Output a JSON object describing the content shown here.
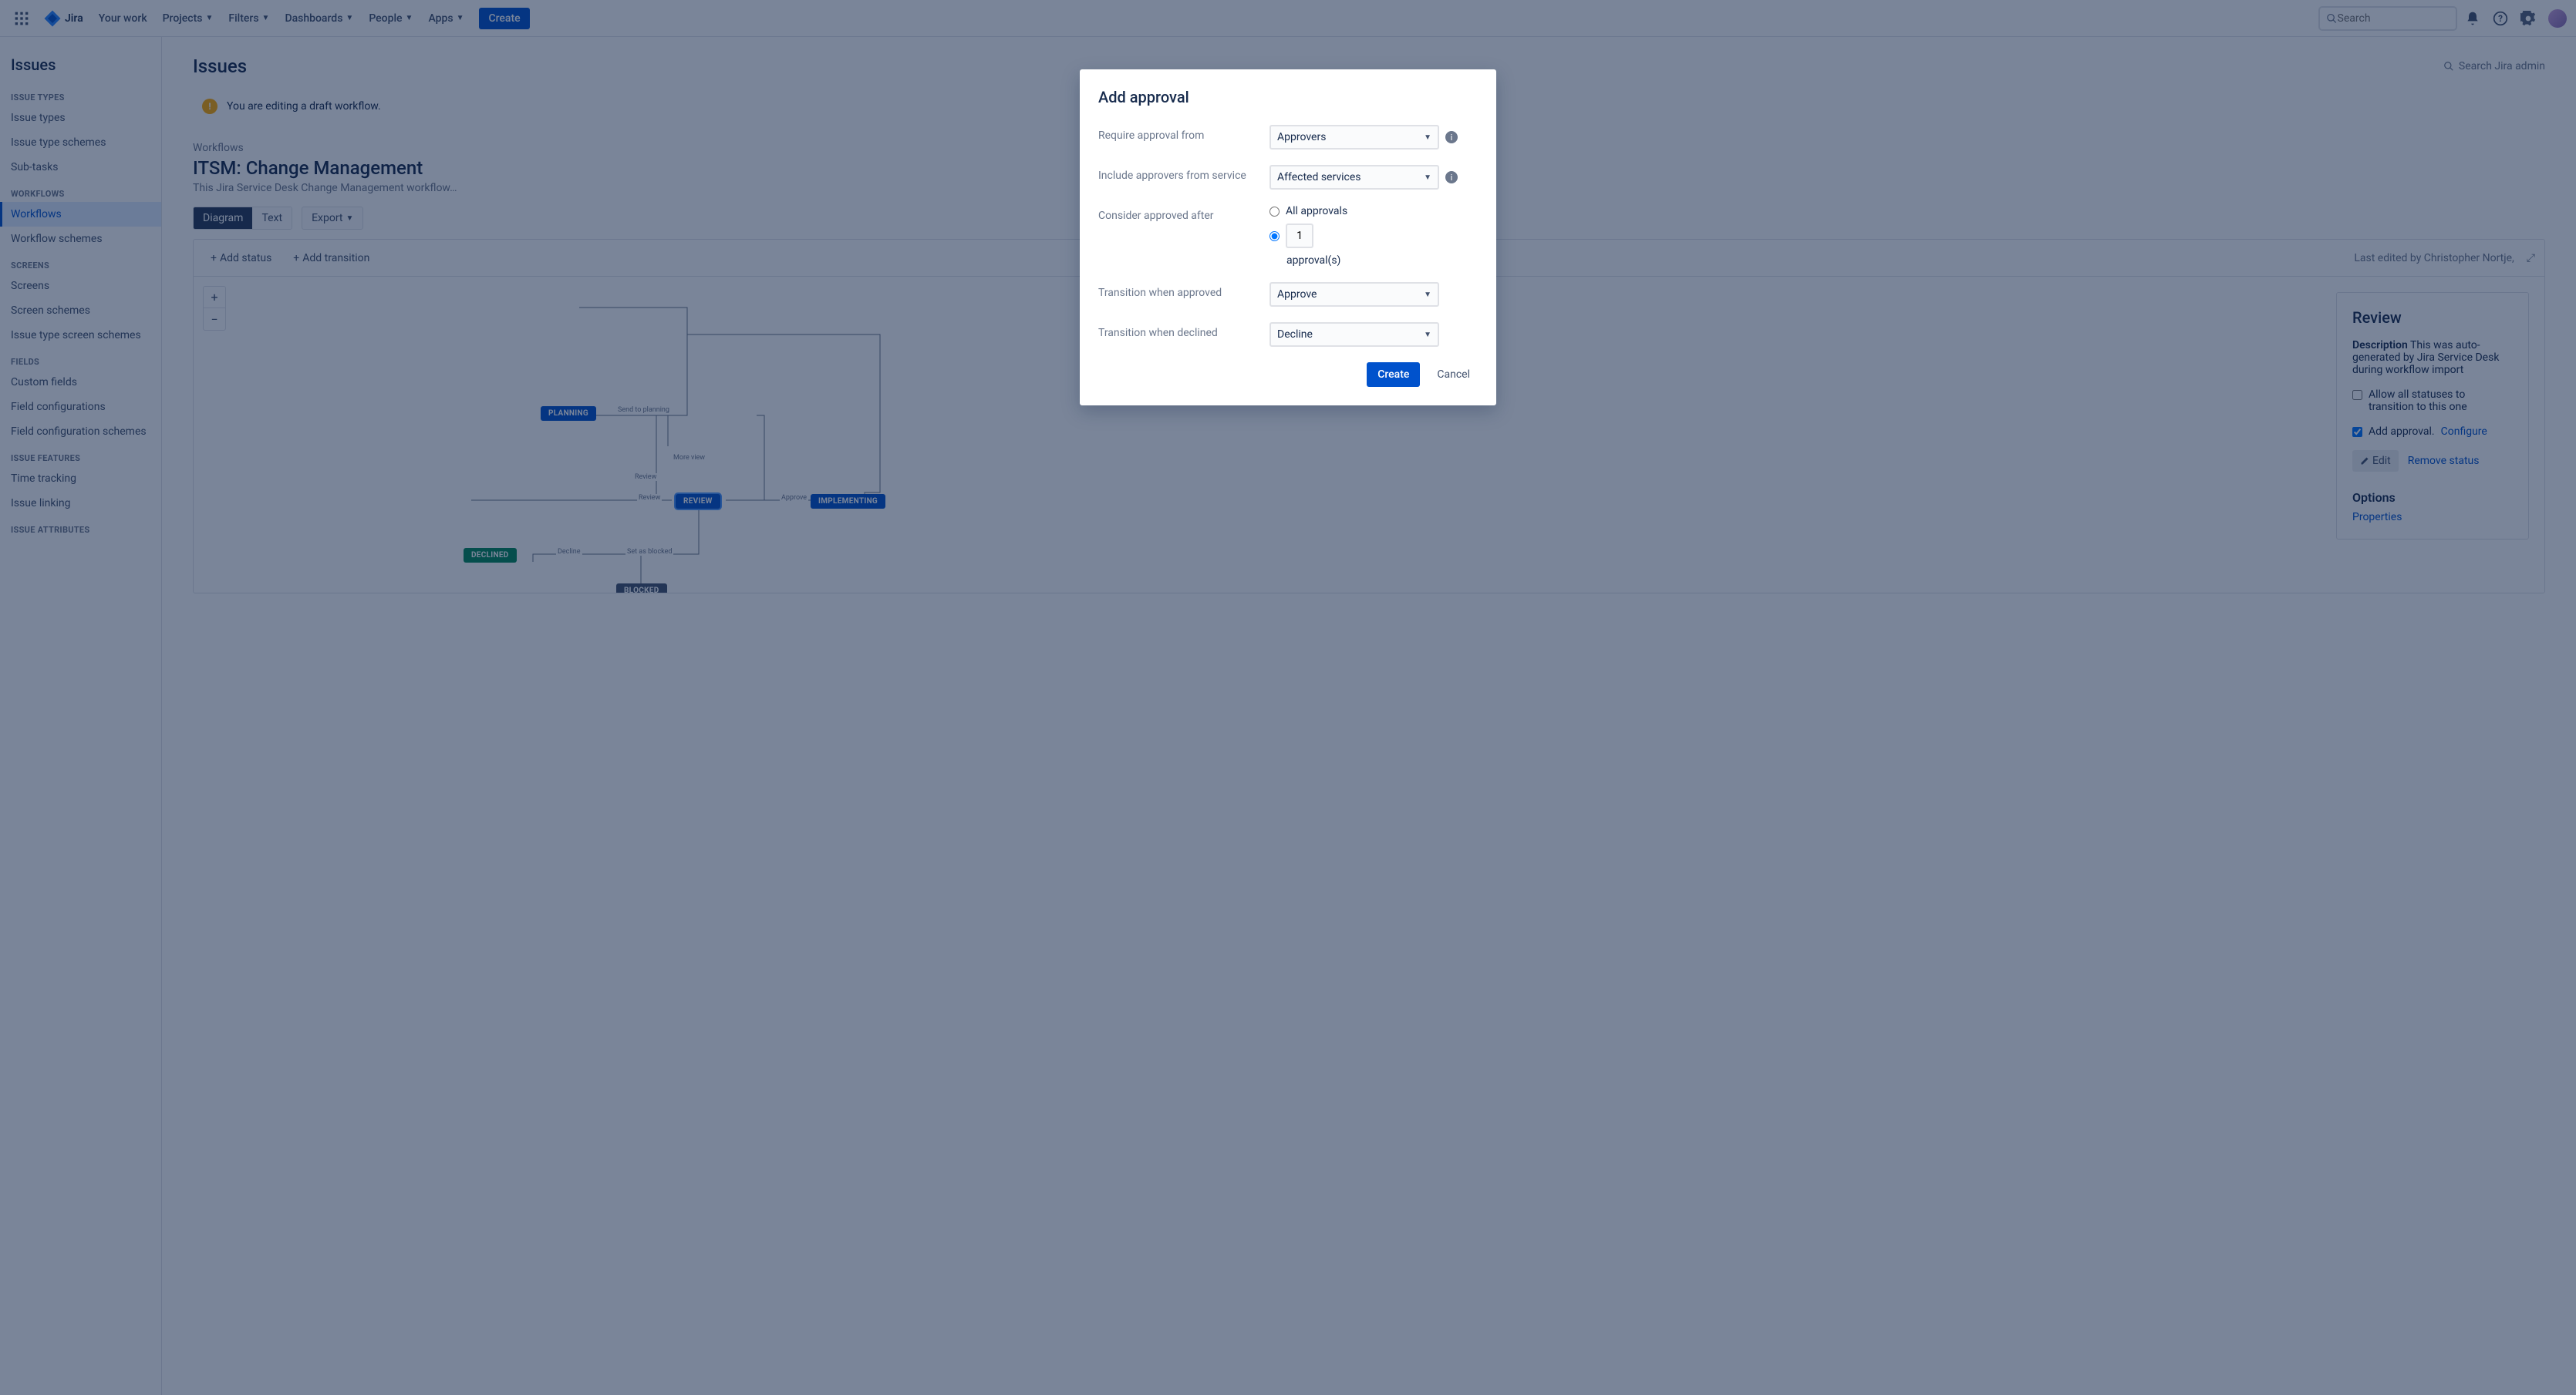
{
  "nav": {
    "product": "Jira",
    "items": [
      "Your work",
      "Projects",
      "Filters",
      "Dashboards",
      "People",
      "Apps"
    ],
    "dropdown_after": 0,
    "create": "Create",
    "search_placeholder": "Search"
  },
  "sidebar": {
    "title": "Issues",
    "sections": [
      {
        "heading": "Issue types",
        "items": [
          "Issue types",
          "Issue type schemes",
          "Sub-tasks"
        ]
      },
      {
        "heading": "Workflows",
        "items": [
          "Workflows",
          "Workflow schemes"
        ],
        "active": 0
      },
      {
        "heading": "Screens",
        "items": [
          "Screens",
          "Screen schemes",
          "Issue type screen schemes"
        ]
      },
      {
        "heading": "Fields",
        "items": [
          "Custom fields",
          "Field configurations",
          "Field configuration schemes"
        ]
      },
      {
        "heading": "Issue features",
        "items": [
          "Time tracking",
          "Issue linking"
        ]
      },
      {
        "heading": "Issue attributes",
        "items": []
      }
    ]
  },
  "main": {
    "page_title": "Issues",
    "admin_search": "Search Jira admin",
    "banner": "You are editing a draft workflow.",
    "breadcrumb": "Workflows",
    "workflow_title": "ITSM: Change Management",
    "workflow_desc": "This Jira Service Desk Change Management workflow…",
    "view_diagram": "Diagram",
    "view_text": "Text",
    "export": "Export",
    "toolbar": {
      "add_status": "Add status",
      "add_transition": "Add transition",
      "last_edited": "Last edited by Christopher Nortje,"
    },
    "nodes": {
      "planning": "Planning",
      "review": "Review",
      "implementing": "Implementing",
      "declined": "Declined",
      "blocked": "Blocked"
    },
    "edges": {
      "send_to_planning": "Send to planning",
      "review1": "Review",
      "review2": "Review",
      "review3": "Review",
      "approve": "Approve",
      "decline": "Decline",
      "set_as_blocked": "Set as blocked",
      "more_view": "More view"
    }
  },
  "panel": {
    "title": "Review",
    "desc_label": "Description",
    "desc_text": "This was auto-generated by Jira Service Desk during workflow import",
    "allow_all": "Allow all statuses to transition to this one",
    "add_approval": "Add approval.",
    "configure": "Configure",
    "edit": "Edit",
    "remove": "Remove status",
    "options": "Options",
    "properties": "Properties"
  },
  "modal": {
    "title": "Add approval",
    "require_from": "Require approval from",
    "approvers": "Approvers",
    "include_service": "Include approvers from service",
    "affected_services": "Affected services",
    "consider_after": "Consider approved after",
    "all_approvals": "All approvals",
    "approval_count": "1",
    "approvals_suffix": "approval(s)",
    "when_approved": "Transition when approved",
    "approve": "Approve",
    "when_declined": "Transition when declined",
    "decline": "Decline",
    "create": "Create",
    "cancel": "Cancel"
  }
}
